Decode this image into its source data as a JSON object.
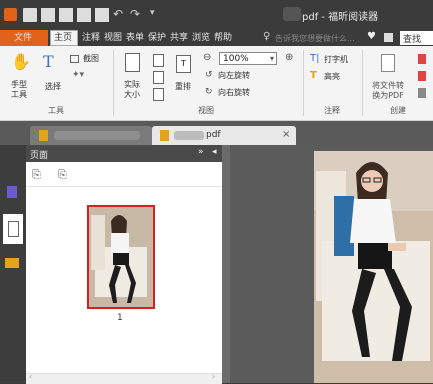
{
  "titlebar": {
    "title": "pdf - 福昕阅读器"
  },
  "tabs": {
    "file": "文件",
    "home": "主页",
    "comment": "注释",
    "view": "视图",
    "form": "表单",
    "protect": "保护",
    "share": "共享",
    "browse": "浏览",
    "help": "帮助",
    "tell_me": "告诉我您想要做什么...",
    "find": "查找"
  },
  "ribbon": {
    "hand": "手型\n工具",
    "select": "选择",
    "snapshot": "截图",
    "actual_size": "实际\n大小",
    "reflow": "重排",
    "zoom": "100%",
    "rotate_left": "向左旋转",
    "rotate_right": "向右旋转",
    "typewriter": "打字机",
    "highlight": "高亮",
    "to_pdf": "将文件转\n换为PDF",
    "group_tools": "工具",
    "group_view": "视图",
    "group_comment": "注释",
    "group_create": "创建"
  },
  "doc_tabs": {
    "tab2_suffix": "pdf"
  },
  "panel": {
    "title": "页面",
    "page_number": "1"
  },
  "colors": {
    "accent": "#e0621b",
    "ribbon_bg": "#f4f4f4",
    "selection": "#d42020"
  }
}
